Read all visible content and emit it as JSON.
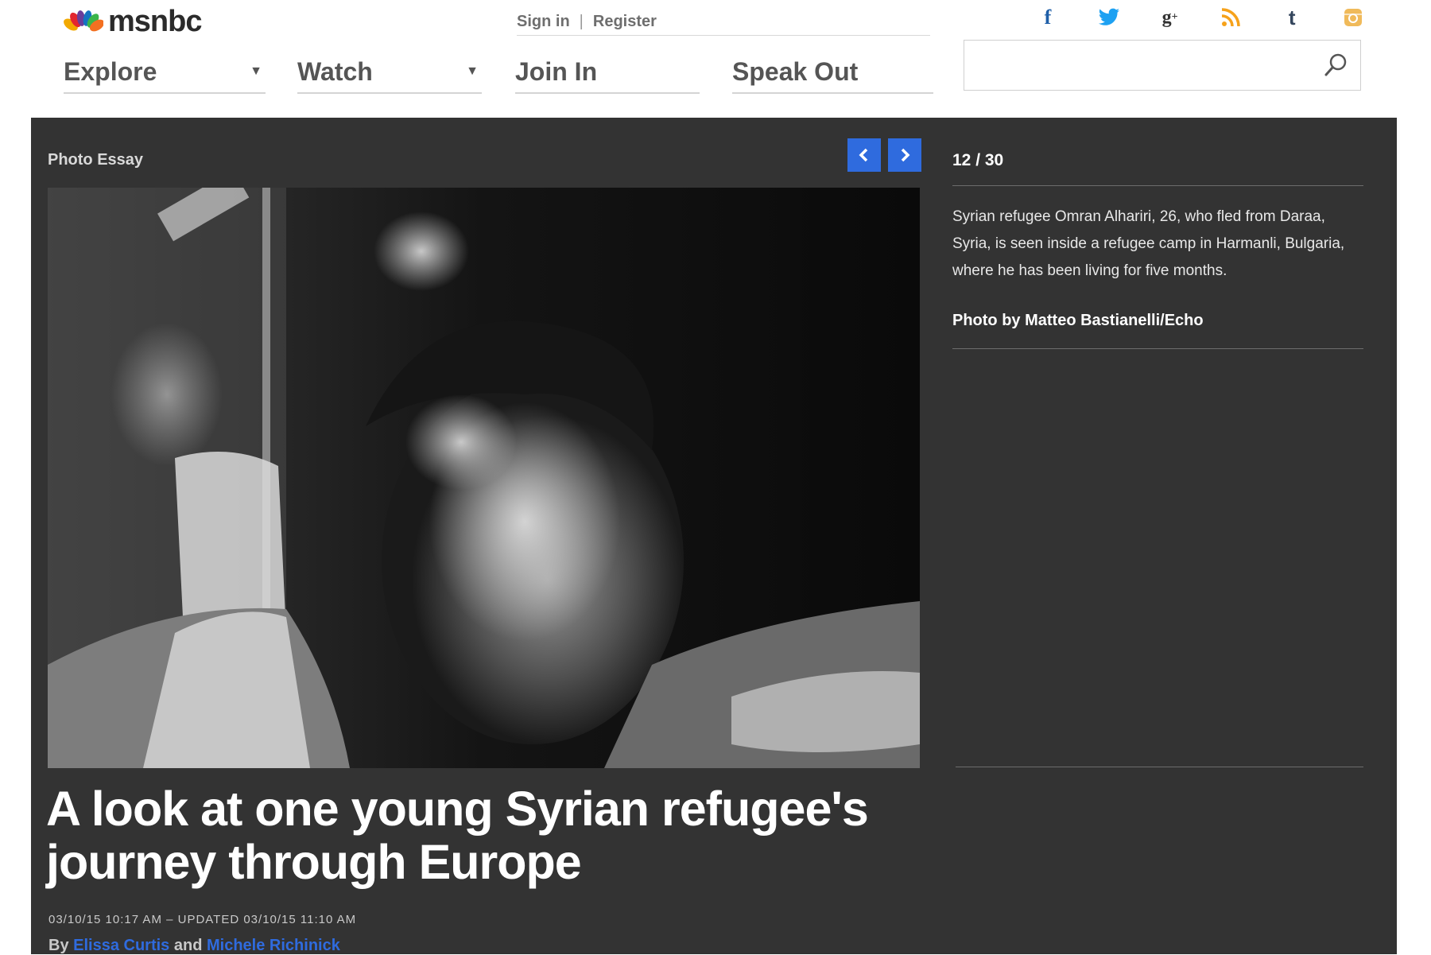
{
  "brand": {
    "name": "msnbc",
    "logo_icon": "peacock-icon",
    "peacock_colors": [
      "#f2a900",
      "#e3262f",
      "#6a3d9a",
      "#1573c1",
      "#3bb54a",
      "#f37021"
    ]
  },
  "account": {
    "signin_label": "Sign in",
    "separator": "|",
    "register_label": "Register"
  },
  "social": [
    {
      "icon": "facebook-icon",
      "glyph": "f",
      "color": "#1f5fa8"
    },
    {
      "icon": "twitter-icon",
      "glyph": "🐦",
      "color": "#1da1f2"
    },
    {
      "icon": "google-plus-icon",
      "glyph": "g+",
      "color": "#333333"
    },
    {
      "icon": "rss-icon",
      "glyph": "",
      "color": "#f6a21b"
    },
    {
      "icon": "tumblr-icon",
      "glyph": "t",
      "color": "#34465d"
    },
    {
      "icon": "instagram-icon",
      "glyph": "",
      "color": "#f0ba5a"
    }
  ],
  "nav": {
    "explore": "Explore",
    "watch": "Watch",
    "join_in": "Join In",
    "speak_out": "Speak Out"
  },
  "search": {
    "placeholder": "",
    "value": "",
    "icon": "search-icon"
  },
  "gallery": {
    "kicker": "Photo Essay",
    "prev_icon": "chevron-left-icon",
    "next_icon": "chevron-right-icon",
    "accent_color": "#2f6bde",
    "counter": "12 / 30",
    "caption": "Syrian refugee Omran Alhariri, 26, who fled from Daraa, Syria, is seen inside a refugee camp in Harmanli, Bulgaria, where he has been living for five months.",
    "credit": "Photo by Matteo Bastianelli/Echo"
  },
  "article": {
    "headline": "A look at one young Syrian refugee's journey through Europe",
    "timestamp": "03/10/15 10:17 AM – UPDATED 03/10/15 11:10 AM",
    "by_label": "By",
    "author1": "Elissa Curtis",
    "and_label": "and",
    "author2": "Michele Richinick"
  }
}
